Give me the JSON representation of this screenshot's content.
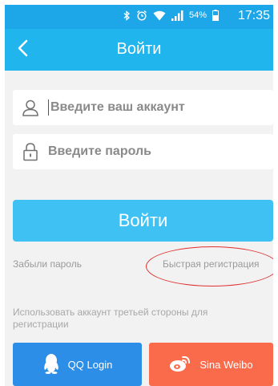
{
  "status_bar": {
    "battery_percent": "54%",
    "time": "17:35",
    "icons": [
      "bluetooth-icon",
      "alarm-icon",
      "wifi-icon",
      "signal-icon",
      "battery-icon"
    ]
  },
  "app_bar": {
    "title": "Войти",
    "back_icon": "chevron-left-icon"
  },
  "form": {
    "account_placeholder": "Введите ваш аккаунт",
    "password_placeholder": "Введите пароль",
    "account_icon": "user-icon",
    "password_icon": "lock-icon"
  },
  "login_button": {
    "label": "Войти"
  },
  "links": {
    "forgot_password": "Забыли пароль",
    "quick_register": "Быстрая регистрация"
  },
  "third_party": {
    "note": "Использовать аккаунт третьей стороны для регистрации",
    "qq_label": "QQ Login",
    "weibo_label": "Sina Weibo"
  },
  "colors": {
    "app_bar": "#21b5ee",
    "login_button": "#3fc2f3",
    "qq": "#2c8ee6",
    "weibo": "#fa6b4b",
    "annotation": "#e03030"
  }
}
